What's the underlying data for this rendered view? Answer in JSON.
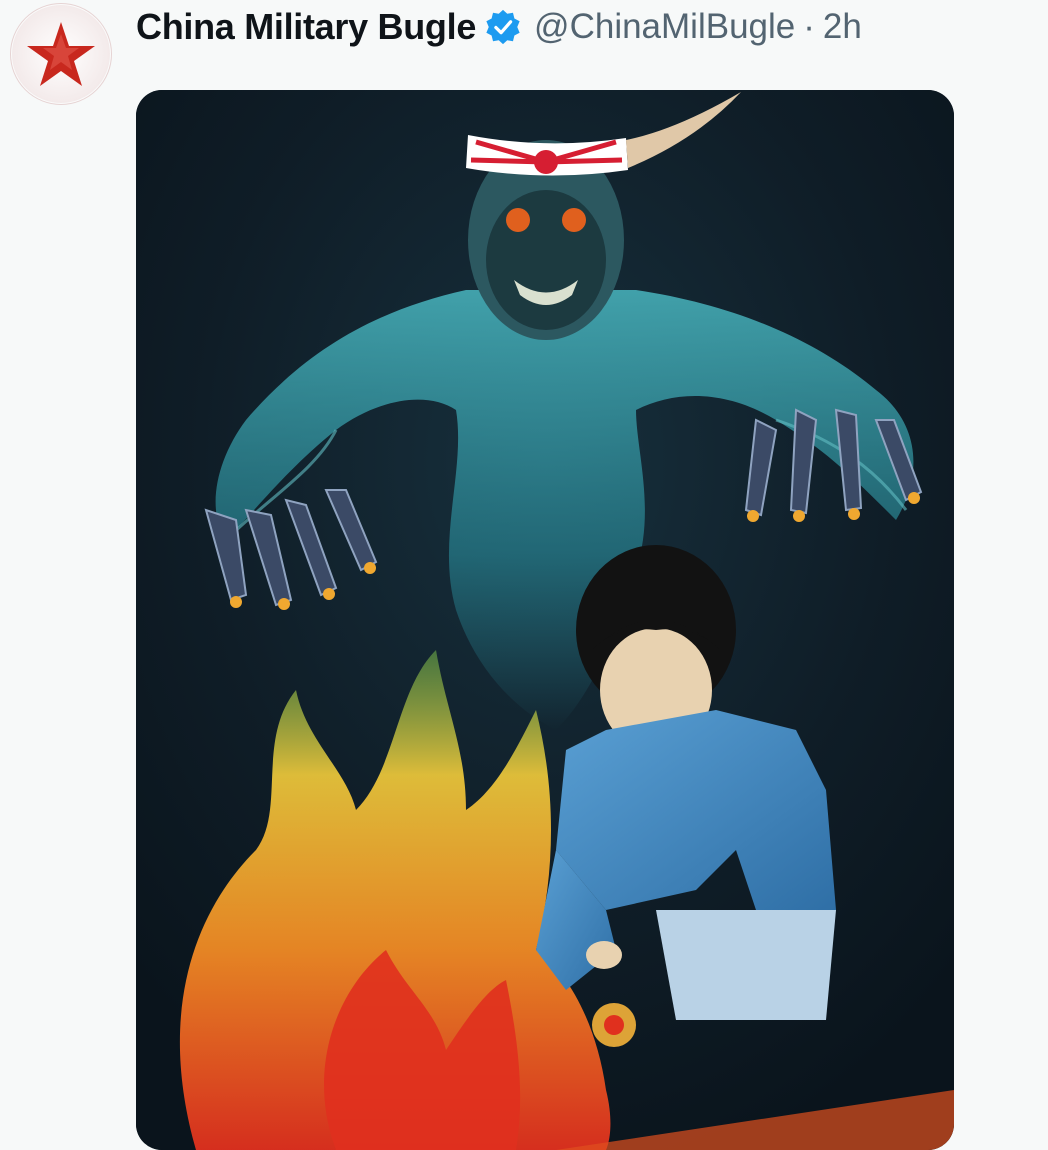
{
  "tweet": {
    "author": {
      "display_name": "China Military Bugle",
      "handle": "@ChinaMilBugle",
      "verified": true,
      "avatar_icon": "red-star-icon"
    },
    "separator": "·",
    "time_ago": "2h",
    "media": {
      "kind": "illustration"
    }
  },
  "colors": {
    "name_text": "#0f1419",
    "muted_text": "#536471",
    "verified_blue": "#1d9bf0",
    "background": "#f7f9f9",
    "avatar_star_red": "#c8281e",
    "illustration_bg": "#0e1a24",
    "ghost_teal": "#3fb8c4",
    "flame_orange": "#f08a24",
    "suit_blue": "#3f86c0"
  }
}
